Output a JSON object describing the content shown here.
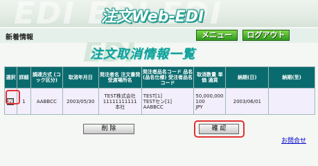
{
  "header": {
    "logo": "注文Web-EDI",
    "watermark": "EDI EDI EDI"
  },
  "nav": {
    "section_label": "新着情報",
    "menu_button": "メニュー",
    "logout_button": "ログアウト"
  },
  "page": {
    "title": "注文取消情報一覧",
    "title_watermark": "EDI"
  },
  "table": {
    "columns": [
      "選択",
      "詳細",
      "調達方式 (コック区分)",
      "取消年月日",
      "発注者名 注文書発 受渡場所名",
      "発注者品名コード 品名(品名仕様) 受注者品名コード",
      "取消数量 単価 通貨",
      "納期(日)",
      "納期(至)"
    ],
    "rows": [
      {
        "checked": "☑",
        "detail": "1",
        "method": "AABBCC",
        "date": "2003/05/30",
        "orderer_1": "TEST株式会社",
        "orderer_2": "11111111111",
        "orderer_3": "本社",
        "item_1": "TEST[1]",
        "item_2": "TESTセン[1]",
        "item_3": "AABBCC",
        "qty_1": "50,000,000",
        "qty_2": "100",
        "qty_3": "JPY",
        "due_from": "2003/06/01",
        "due_to": ""
      }
    ]
  },
  "buttons": {
    "delete": "削 除",
    "confirm": "確 認",
    "help": "お問合せ"
  },
  "colors": {
    "table_header": "#0a6b6e",
    "row_background": "#f3eefc",
    "highlight": "#e23030",
    "nav_button": "#2f9a1f",
    "title": "#0fa09a"
  }
}
